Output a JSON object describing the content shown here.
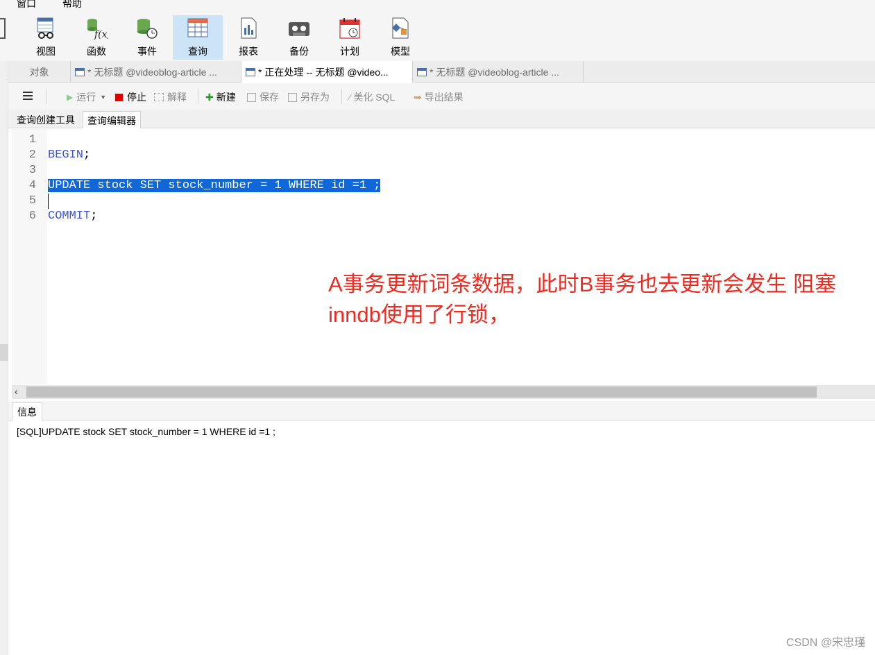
{
  "menu": {
    "items": [
      "窗口",
      "帮助"
    ]
  },
  "ribbon": {
    "buttons": [
      {
        "label": "视图",
        "icon": "view-icon"
      },
      {
        "label": "函数",
        "icon": "function-icon"
      },
      {
        "label": "事件",
        "icon": "event-icon"
      },
      {
        "label": "查询",
        "icon": "query-icon",
        "active": true
      },
      {
        "label": "报表",
        "icon": "report-icon"
      },
      {
        "label": "备份",
        "icon": "backup-icon"
      },
      {
        "label": "计划",
        "icon": "schedule-icon"
      },
      {
        "label": "模型",
        "icon": "model-icon"
      }
    ]
  },
  "doc_tabs": [
    {
      "label": "对象"
    },
    {
      "label": "* 无标题 @videoblog-article ..."
    },
    {
      "label": "* 正在处理 -- 无标题 @video...",
      "active": true
    },
    {
      "label": "* 无标题 @videoblog-article ..."
    }
  ],
  "toolbar": {
    "run": "运行",
    "stop": "停止",
    "explain": "解释",
    "new": "新建",
    "save": "保存",
    "save_as": "另存为",
    "beautify": "美化 SQL",
    "export": "导出结果"
  },
  "sub_tabs": [
    {
      "label": "查询创建工具"
    },
    {
      "label": "查询编辑器",
      "active": true
    }
  ],
  "editor": {
    "line_numbers": [
      "1",
      "2",
      "3",
      "4",
      "5",
      "6"
    ],
    "lines": {
      "l2": "BEGIN",
      "l2_end": ";",
      "l4": "UPDATE stock SET stock_number = 1 WHERE id =1 ;",
      "l6": "COMMIT",
      "l6_end": ";"
    }
  },
  "annotation": {
    "line1": "A事务更新词条数据，此时B事务也去更新会发生 阻塞",
    "line2": " inndb使用了行锁，"
  },
  "info": {
    "tab_label": "信息",
    "message": "[SQL]UPDATE stock SET stock_number = 1 WHERE id =1 ;"
  },
  "watermark": "CSDN @宋忠瑾",
  "colors": {
    "keyword": "#3b55d6",
    "selection": "#0f67d8",
    "annotation": "#f02a20",
    "active_ribbon": "#cde4f7"
  }
}
